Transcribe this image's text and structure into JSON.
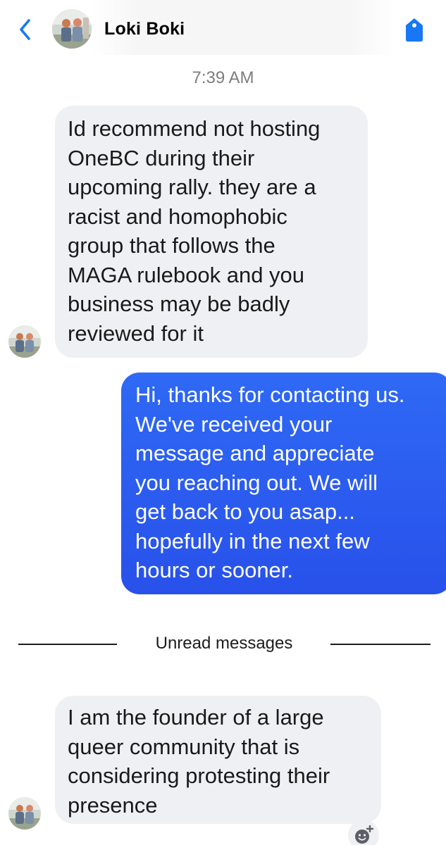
{
  "header": {
    "contact_name": "Loki Boki",
    "back_icon": "chevron-left-icon",
    "tag_icon": "tag-icon",
    "accent_color": "#1877f2"
  },
  "conversation": {
    "timestamp": "7:39 AM",
    "messages": [
      {
        "direction": "incoming",
        "text": "Id recommend not hosting\nOneBC during their\nupcoming rally. they are a\nracist and homophobic\ngroup that follows the\nMAGA rulebook and you\nbusiness may be  badly\nreviewed for it"
      },
      {
        "direction": "outgoing",
        "text": "Hi, thanks for contacting us.\nWe've received your\nmessage and appreciate\nyou reaching out. We will\nget back to you asap...\nhopefully in the next few\nhours or sooner."
      },
      {
        "direction": "incoming",
        "text": "I am the founder of a large\nqueer community that is\nconsidering protesting their\npresence"
      }
    ],
    "divider_label": "Unread messages",
    "reaction_icon": "add-reaction-icon"
  },
  "colors": {
    "incoming_bubble": "#eff0f3",
    "outgoing_bubble": "#2a5cf0",
    "timestamp_text": "#7d7d80"
  }
}
